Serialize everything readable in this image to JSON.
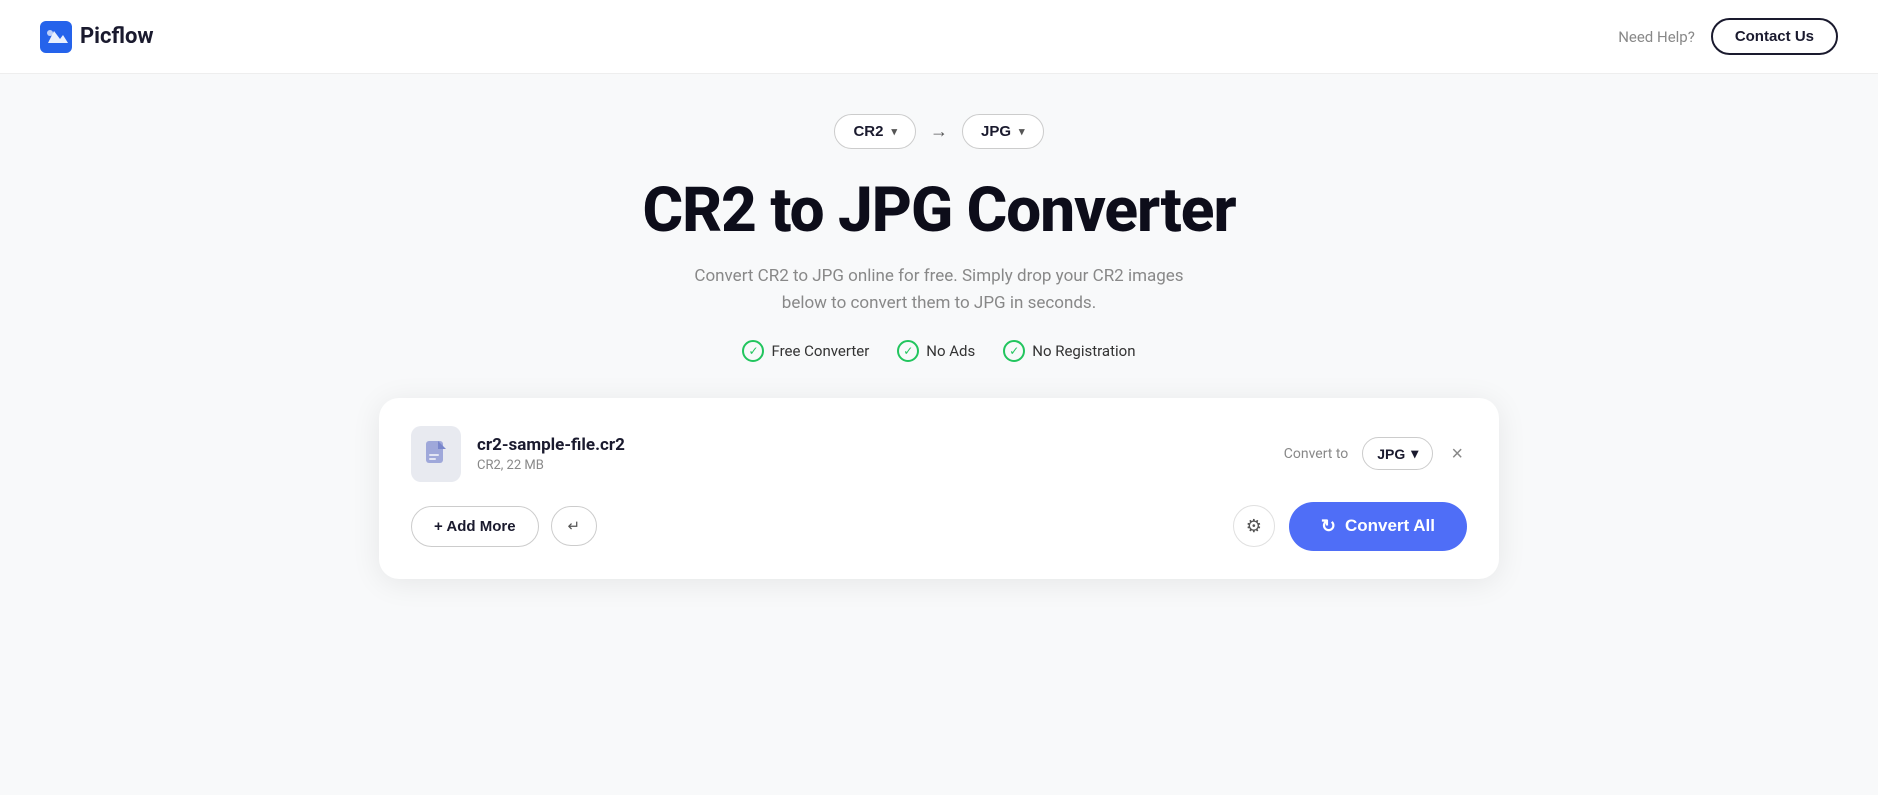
{
  "header": {
    "logo_text": "Picflow",
    "need_help_label": "Need Help?",
    "contact_us_label": "Contact Us"
  },
  "format_selector": {
    "from_format": "CR2",
    "to_format": "JPG",
    "arrow": "→"
  },
  "page": {
    "title": "CR2 to JPG Converter",
    "subtitle": "Convert CR2 to JPG online for free. Simply drop your CR2 images below to convert them to JPG in seconds."
  },
  "badges": [
    {
      "label": "Free Converter"
    },
    {
      "label": "No Ads"
    },
    {
      "label": "No Registration"
    }
  ],
  "file_row": {
    "file_name": "cr2-sample-file.cr2",
    "file_meta": "CR2, 22 MB",
    "convert_to_label": "Convert to",
    "output_format": "JPG"
  },
  "buttons": {
    "add_more": "+ Add More",
    "enter_symbol": "↵",
    "convert_all": "Convert All"
  }
}
